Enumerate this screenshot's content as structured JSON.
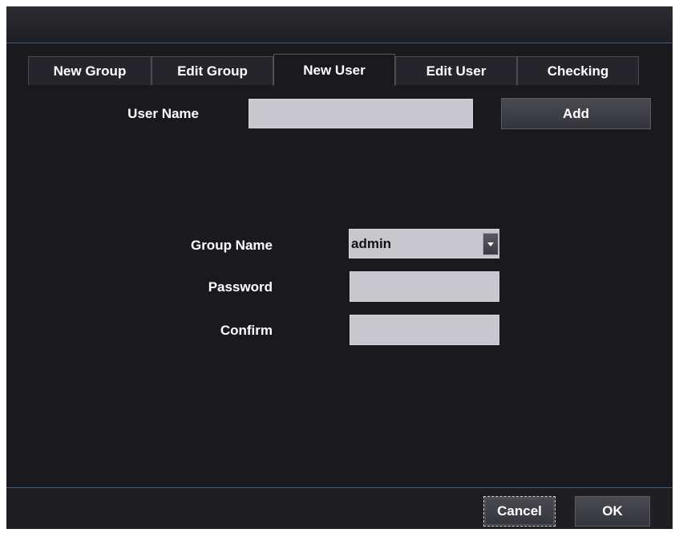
{
  "tabs": [
    {
      "label": "New Group",
      "active": false
    },
    {
      "label": "Edit Group",
      "active": false
    },
    {
      "label": "New User",
      "active": true
    },
    {
      "label": "Edit User",
      "active": false
    },
    {
      "label": "Checking",
      "active": false
    }
  ],
  "user_name": {
    "label": "User Name",
    "value": ""
  },
  "add_button": {
    "label": "Add"
  },
  "group_name": {
    "label": "Group Name",
    "selected": "admin"
  },
  "password": {
    "label": "Password",
    "value": ""
  },
  "confirm": {
    "label": "Confirm",
    "value": ""
  },
  "footer": {
    "cancel_label": "Cancel",
    "ok_label": "OK"
  },
  "colors": {
    "background": "#1a191e",
    "input": "#c8c7cd",
    "accent_line": "#3a5f86"
  }
}
